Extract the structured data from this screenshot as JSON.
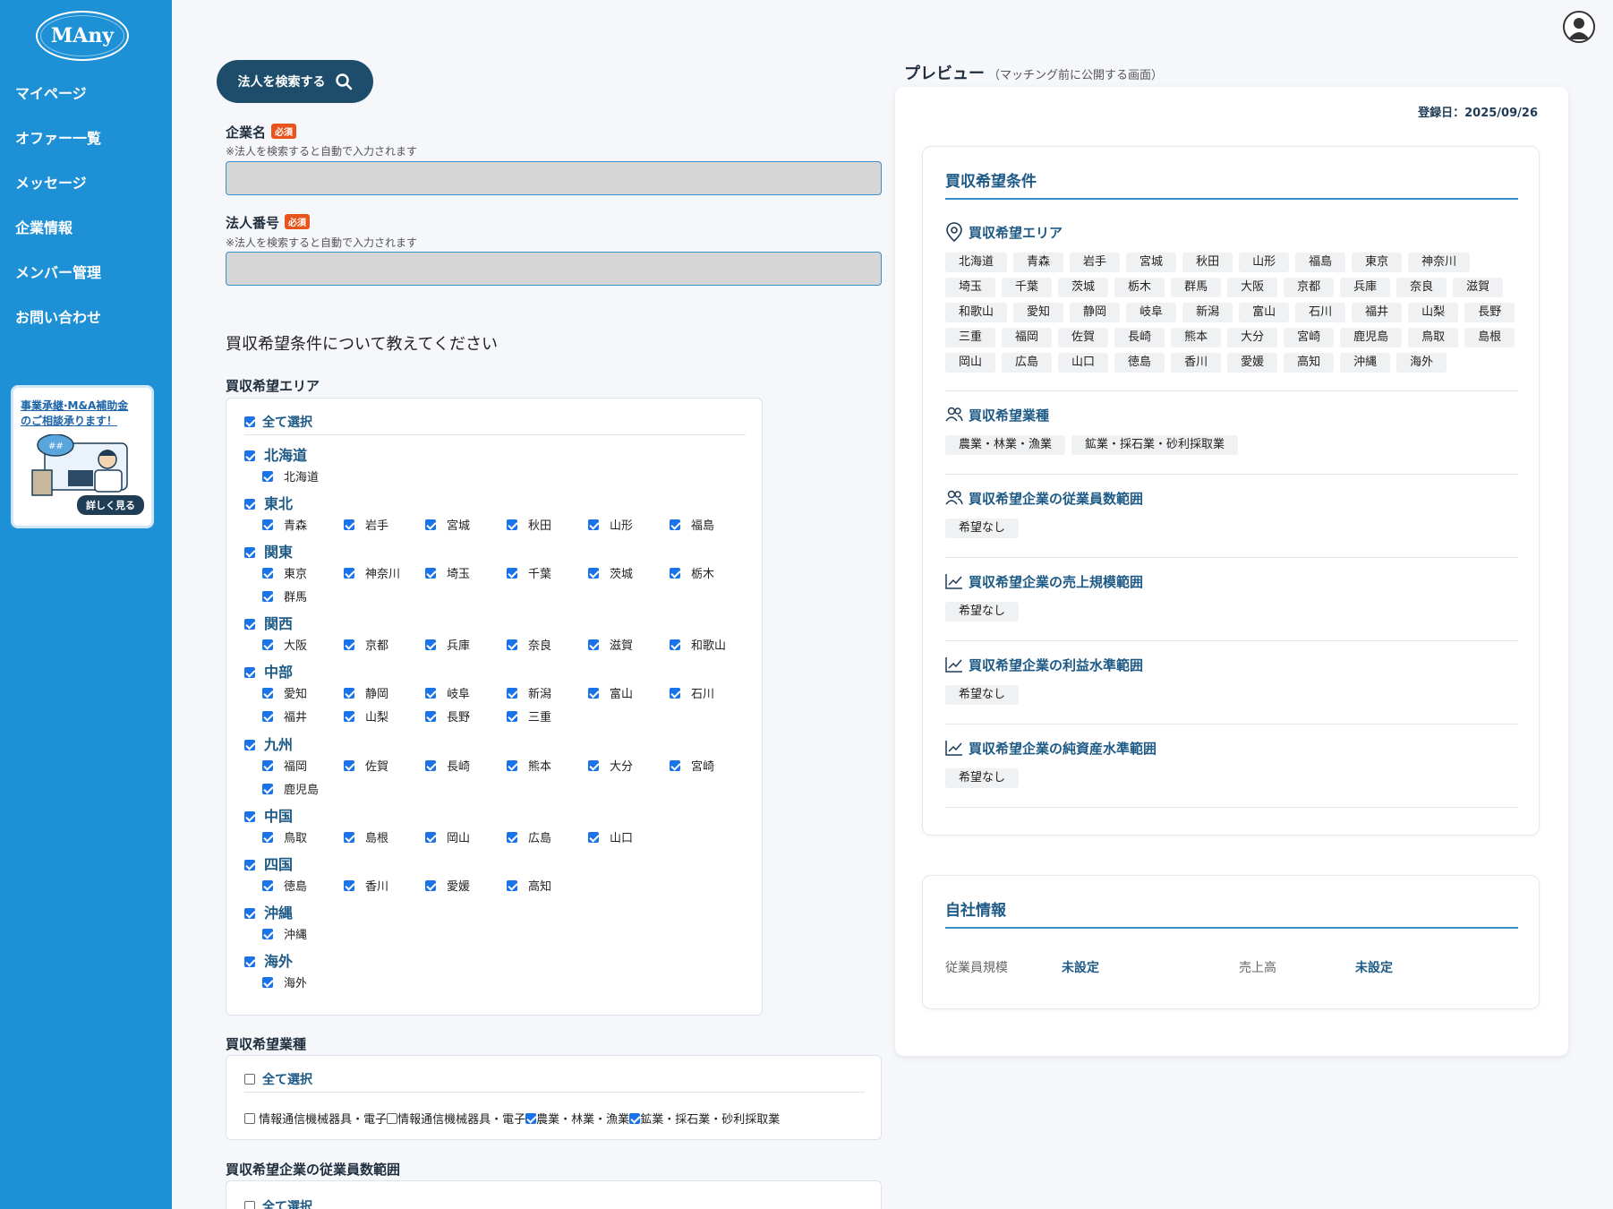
{
  "brand": {
    "logo": "MAny"
  },
  "sidebar": {
    "items": [
      {
        "label": "マイページ"
      },
      {
        "label": "オファー一覧"
      },
      {
        "label": "メッセージ"
      },
      {
        "label": "企業情報"
      },
      {
        "label": "メンバー管理"
      },
      {
        "label": "お問い合わせ"
      }
    ],
    "banner": {
      "line1": "事業承継·M&A補助金",
      "line2": "のご相談承ります！",
      "button": "詳しく見る"
    }
  },
  "form": {
    "search_button": "法人を検索する",
    "required_badge": "必須",
    "company_name": {
      "label": "企業名",
      "note": "※法人を検索すると自動で入力されます",
      "value": ""
    },
    "corp_number": {
      "label": "法人番号",
      "note": "※法人を検索すると自動で入力されます",
      "value": ""
    },
    "question": "買収希望条件について教えてください",
    "area": {
      "title": "買収希望エリア",
      "select_all": "全て選択",
      "regions": [
        {
          "name": "北海道",
          "prefs": [
            "北海道"
          ]
        },
        {
          "name": "東北",
          "prefs": [
            "青森",
            "岩手",
            "宮城",
            "秋田",
            "山形",
            "福島"
          ]
        },
        {
          "name": "関東",
          "prefs": [
            "東京",
            "神奈川",
            "埼玉",
            "千葉",
            "茨城",
            "栃木",
            "群馬"
          ]
        },
        {
          "name": "関西",
          "prefs": [
            "大阪",
            "京都",
            "兵庫",
            "奈良",
            "滋賀",
            "和歌山"
          ]
        },
        {
          "name": "中部",
          "prefs": [
            "愛知",
            "静岡",
            "岐阜",
            "新潟",
            "富山",
            "石川",
            "福井",
            "山梨",
            "長野",
            "三重"
          ]
        },
        {
          "name": "九州",
          "prefs": [
            "福岡",
            "佐賀",
            "長崎",
            "熊本",
            "大分",
            "宮崎",
            "鹿児島"
          ]
        },
        {
          "name": "中国",
          "prefs": [
            "鳥取",
            "島根",
            "岡山",
            "広島",
            "山口"
          ]
        },
        {
          "name": "四国",
          "prefs": [
            "徳島",
            "香川",
            "愛媛",
            "高知"
          ]
        },
        {
          "name": "沖縄",
          "prefs": [
            "沖縄"
          ]
        },
        {
          "name": "海外",
          "prefs": [
            "海外"
          ]
        }
      ]
    },
    "industry": {
      "title": "買収希望業種",
      "select_all": "全て選択",
      "row_text_1": "情報通信機械器具・電子",
      "row_text_2": "情報通信機械器具・電子",
      "row_text_3": "農業・林業・漁業",
      "row_text_4": "鉱業・採石業・砂利採取業"
    },
    "employees": {
      "title": "買収希望企業の従業員数範囲",
      "select_all": "全て選択"
    }
  },
  "preview": {
    "title": "プレビュー",
    "subtitle": "（マッチング前に公開する画面）",
    "registered": "登録日：2025/09/26",
    "conditions_title": "買収希望条件",
    "area_title": "買収希望エリア",
    "area_tags": [
      "北海道",
      "青森",
      "岩手",
      "宮城",
      "秋田",
      "山形",
      "福島",
      "東京",
      "神奈川",
      "埼玉",
      "千葉",
      "茨城",
      "栃木",
      "群馬",
      "大阪",
      "京都",
      "兵庫",
      "奈良",
      "滋賀",
      "和歌山",
      "愛知",
      "静岡",
      "岐阜",
      "新潟",
      "富山",
      "石川",
      "福井",
      "山梨",
      "長野",
      "三重",
      "福岡",
      "佐賀",
      "長崎",
      "熊本",
      "大分",
      "宮崎",
      "鹿児島",
      "鳥取",
      "島根",
      "岡山",
      "広島",
      "山口",
      "徳島",
      "香川",
      "愛媛",
      "高知",
      "沖縄",
      "海外"
    ],
    "industry_title": "買収希望業種",
    "industry_tags": [
      "農業・林業・漁業",
      "鉱業・採石業・砂利採取業"
    ],
    "employees_title": "買収希望企業の従業員数範囲",
    "employees_value": "希望なし",
    "sales_title": "買収希望企業の売上規模範囲",
    "sales_value": "希望なし",
    "profit_title": "買収希望企業の利益水準範囲",
    "profit_value": "希望なし",
    "assets_title": "買収希望企業の純資産水準範囲",
    "assets_value": "希望なし",
    "own_title": "自社情報",
    "own_employees_label": "従業員規模",
    "own_employees_value": "未設定",
    "own_sales_label": "売上高",
    "own_sales_value": "未設定"
  },
  "colors": {
    "sidebar": "#1e90d6",
    "accent": "#1e5a86",
    "required": "#e8541c",
    "checkbox": "#1a73e8"
  }
}
